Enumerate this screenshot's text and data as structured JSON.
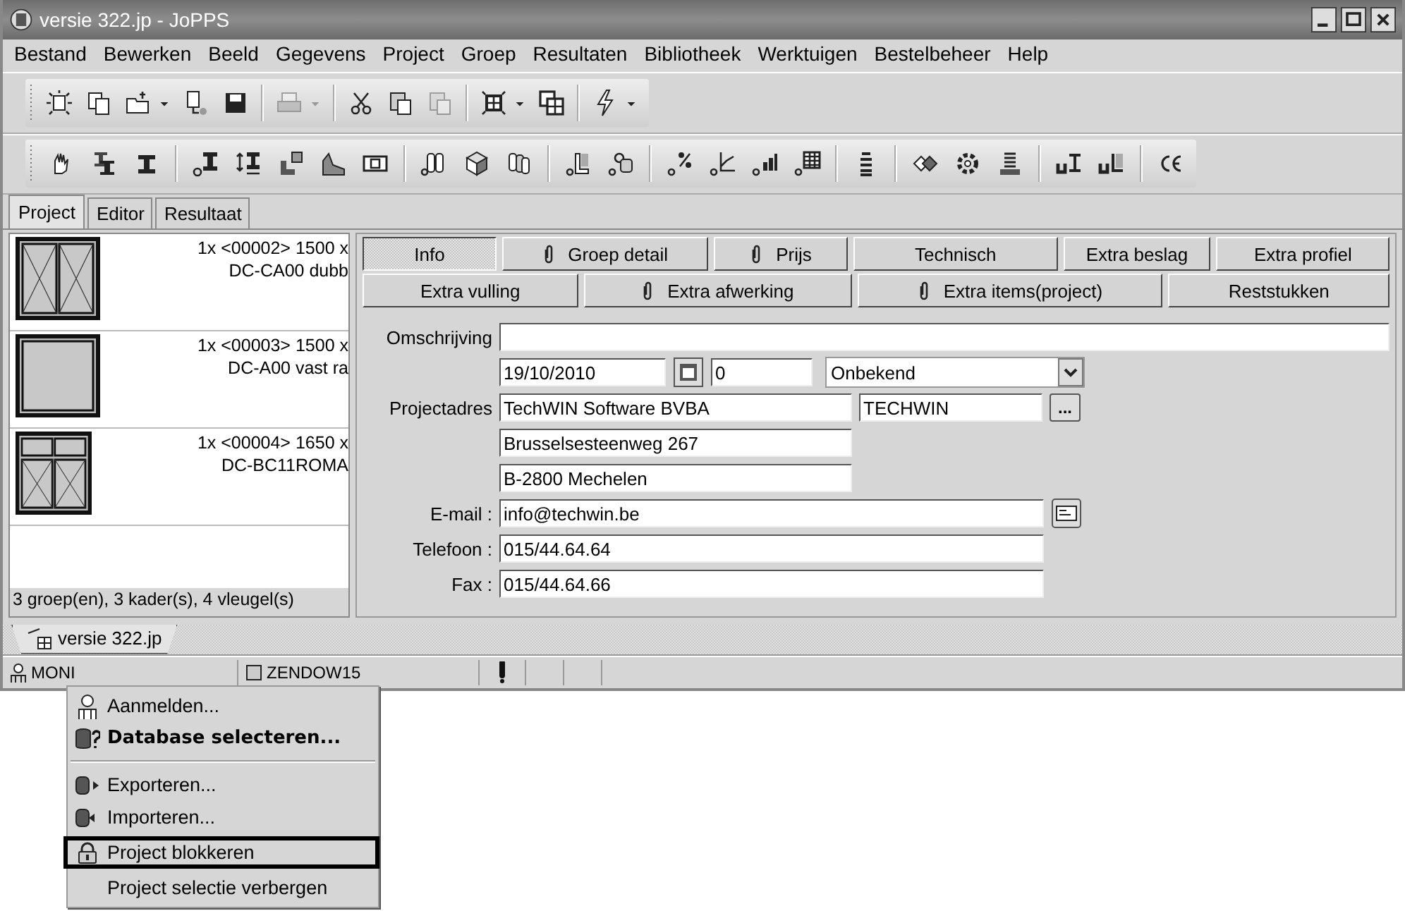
{
  "window": {
    "title": "versie 322.jp - JoPPS"
  },
  "menu": [
    "Bestand",
    "Bewerken",
    "Beeld",
    "Gegevens",
    "Project",
    "Groep",
    "Resultaten",
    "Bibliotheek",
    "Werktuigen",
    "Bestelbeheer",
    "Help"
  ],
  "toolbars": [
    {
      "buttons": [
        {
          "disabled": false
        },
        {
          "disabled": false
        },
        {
          "disabled": false
        },
        {
          "disabled": false
        },
        {
          "disabled": false
        },
        {
          "disabled": true
        },
        {
          "disabled": false
        },
        {
          "disabled": false
        },
        {
          "disabled": true
        },
        {
          "disabled": false
        },
        {
          "disabled": false
        },
        {
          "disabled": false
        }
      ]
    },
    {
      "buttons": [
        {
          "disabled": false
        },
        {
          "disabled": false
        },
        {
          "disabled": false
        },
        {
          "disabled": false
        },
        {
          "disabled": false
        },
        {
          "disabled": false
        },
        {
          "disabled": false
        },
        {
          "disabled": false
        },
        {
          "disabled": false
        },
        {
          "disabled": false
        },
        {
          "disabled": false
        },
        {
          "disabled": false
        },
        {
          "disabled": false
        },
        {
          "disabled": false
        },
        {
          "disabled": false
        },
        {
          "disabled": false
        },
        {
          "disabled": false
        },
        {
          "disabled": false
        },
        {
          "disabled": false
        },
        {
          "disabled": false
        },
        {
          "disabled": false
        },
        {
          "disabled": false
        },
        {
          "disabled": false
        },
        {
          "disabled": false
        }
      ]
    }
  ],
  "tabs": [
    {
      "label": "Project",
      "selected": true
    },
    {
      "label": "Editor",
      "selected": false
    },
    {
      "label": "Resultaat",
      "selected": false
    }
  ],
  "project_list": {
    "items": [
      {
        "kind": "double-casement",
        "lines": [
          "1x <00002> 1500 x",
          "DC-CA00 dubb"
        ]
      },
      {
        "kind": "fixed",
        "lines": [
          "1x <00003> 1500 x",
          "DC-A00 vast ra"
        ]
      },
      {
        "kind": "transom-double-casement",
        "lines": [
          "1x <00004> 1650 x",
          "DC-BC11ROMA"
        ]
      }
    ],
    "summary": "3 groep(en), 3 kader(s), 4 vleugel(s)"
  },
  "detail_buttons": [
    [
      {
        "label": "Info",
        "selected": true,
        "attachment": false
      },
      {
        "label": "Groep detail",
        "selected": false,
        "attachment": true
      },
      {
        "label": "Prijs",
        "selected": false,
        "attachment": true
      },
      {
        "label": "Technisch",
        "selected": false,
        "attachment": false
      },
      {
        "label": "Extra beslag",
        "selected": false,
        "attachment": false
      },
      {
        "label": "Extra profiel",
        "selected": false,
        "attachment": false
      }
    ],
    [
      {
        "label": "Extra vulling",
        "selected": false,
        "attachment": false
      },
      {
        "label": "Extra afwerking",
        "selected": false,
        "attachment": true
      },
      {
        "label": "Extra items(project)",
        "selected": false,
        "attachment": true
      },
      {
        "label": "Reststukken",
        "selected": false,
        "attachment": false
      }
    ]
  ],
  "form": {
    "description_label": "Omschrijving",
    "date": "19/10/2010",
    "number": "0",
    "status": "Onbekend",
    "address": {
      "label": "Projectadres",
      "lines": [
        "TechWIN Software BVBA",
        "Brusselsesteenweg 267",
        "B-2800 Mechelen"
      ],
      "short_name": "TECHWIN",
      "browse_button": "..."
    },
    "email": {
      "label": "E-mail :",
      "value": "info@techwin.be"
    },
    "phone": {
      "label": "Telefoon :",
      "value": "015/44.64.64"
    },
    "fax": {
      "label": "Fax :",
      "value": "015/44.64.66"
    }
  },
  "document_tabs": [
    {
      "label": "versie 322.jp",
      "selected": true
    }
  ],
  "status_bar": [
    "MONI",
    "ZENDOW15"
  ],
  "context_menu": {
    "items": [
      {
        "kind": "item",
        "label": "Aanmelden...",
        "default": false,
        "selected": false
      },
      {
        "kind": "item",
        "label": "Database selecteren...",
        "default": true,
        "selected": false
      },
      {
        "kind": "separator"
      },
      {
        "kind": "item",
        "label": "Exporteren...",
        "default": false,
        "selected": false
      },
      {
        "kind": "item",
        "label": "Importeren...",
        "default": false,
        "selected": false
      },
      {
        "kind": "item",
        "label": "Project blokkeren",
        "default": false,
        "selected": true
      },
      {
        "kind": "item",
        "label": "Project selectie verbergen",
        "default": false,
        "selected": false
      }
    ]
  }
}
